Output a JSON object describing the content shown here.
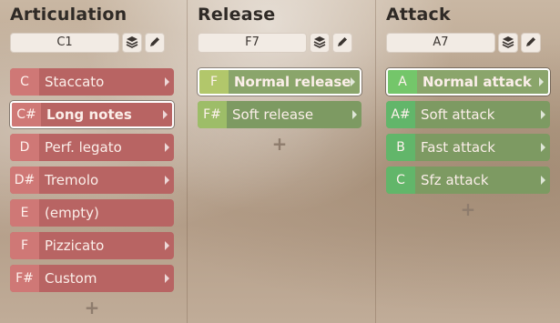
{
  "columns": [
    {
      "heading": "Articulation",
      "key_field": "C1",
      "slots": [
        {
          "key": "C",
          "label": "Staccato"
        },
        {
          "key": "C#",
          "label": "Long notes"
        },
        {
          "key": "D",
          "label": "Perf. legato"
        },
        {
          "key": "D#",
          "label": "Tremolo"
        },
        {
          "key": "E",
          "label": "(empty)"
        },
        {
          "key": "F",
          "label": "Pizzicato"
        },
        {
          "key": "F#",
          "label": "Custom"
        }
      ],
      "add_label": "+"
    },
    {
      "heading": "Release",
      "key_field": "F7",
      "slots": [
        {
          "key": "F",
          "label": "Normal release"
        },
        {
          "key": "F#",
          "label": "Soft release"
        }
      ],
      "add_label": "+"
    },
    {
      "heading": "Attack",
      "key_field": "A7",
      "slots": [
        {
          "key": "A",
          "label": "Normal attack"
        },
        {
          "key": "A#",
          "label": "Soft attack"
        },
        {
          "key": "B",
          "label": "Fast attack"
        },
        {
          "key": "C",
          "label": "Sfz attack"
        }
      ],
      "add_label": "+"
    }
  ],
  "icons": {
    "layers": "layers-icon",
    "edit": "pencil-icon",
    "arrow": "chevron-right-icon",
    "add": "plus-icon"
  },
  "colors": {
    "articulation_slot": "#b86463",
    "release_slot": "#7d9a62",
    "attack_slot": "#7d9a62",
    "selected_border": "#ffffff"
  }
}
